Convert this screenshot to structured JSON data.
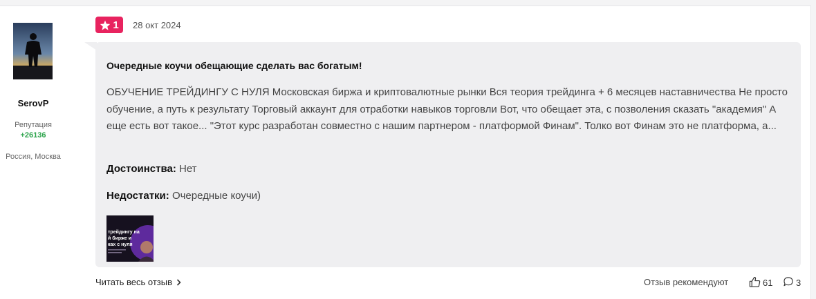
{
  "author": {
    "name": "SerovP",
    "reputation_label": "Репутация",
    "reputation_value": "+26136",
    "location": "Россия, Москва"
  },
  "review": {
    "rating": "1",
    "date": "28 окт 2024",
    "title": "Очередные коучи обещающие сделать вас богатым!",
    "text": "ОБУЧЕНИЕ ТРЕЙДИНГУ С НУЛЯ Московская биржа и криптовалютные рынки Вся теория трейдинга + 6 месяцев наставничества Не просто обучение, а путь к результату Торговый аккаунт для отработки навыков торговли Вот, что обещает эта, с позволения сказать \"академия\" А еще есть вот такое... \"Этот курс разработан совместно с нашим партнером - платформой Финам\". Толко вот Финам это не платформа, а...",
    "pros_label": "Достоинства:",
    "pros_value": "Нет",
    "cons_label": "Недостатки:",
    "cons_value": "Очередные коучи)",
    "image_caption": "трейдингу на\nй бирже и\nках с нуля"
  },
  "footer": {
    "read_more": "Читать весь отзыв",
    "recommend_text": "Отзыв рекомендуют",
    "likes": "61",
    "comments": "3"
  },
  "colors": {
    "badge": "#e8235f",
    "reputation": "#2aa34a",
    "bubble": "#efeff1"
  }
}
